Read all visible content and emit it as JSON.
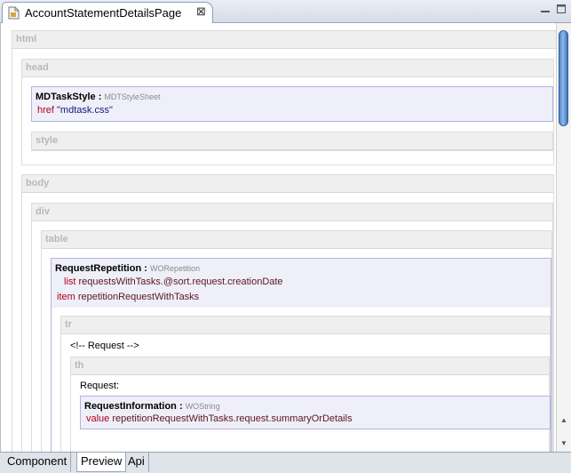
{
  "editor": {
    "tab_title": "AccountStatementDetailsPage",
    "close_symbol": "⊠"
  },
  "tree": {
    "html": "html",
    "head": "head",
    "style": "style",
    "body": "body",
    "div": "div",
    "table": "table",
    "tr": "tr",
    "th": "th",
    "comment": "<!-- Request -->",
    "request_text": "Request:",
    "mdtaskstyle": {
      "name": "MDTaskStyle",
      "sep": " : ",
      "type": "MDTStyleSheet",
      "bindings": [
        {
          "key": "href",
          "value": "\"mdtask.css\""
        }
      ]
    },
    "request_repetition": {
      "name": "RequestRepetition",
      "sep": " : ",
      "type": "WORepetition",
      "bindings": [
        {
          "key": "list",
          "value": "requestsWithTasks.@sort.request.creationDate"
        },
        {
          "key": "item",
          "value": "repetitionRequestWithTasks"
        }
      ]
    },
    "request_information": {
      "name": "RequestInformation",
      "sep": " : ",
      "type": "WOString",
      "bindings": [
        {
          "key": "value",
          "value": "repetitionRequestWithTasks.request.summaryOrDetails"
        }
      ]
    }
  },
  "bottom_tabs": [
    "Component",
    "Preview",
    "Api"
  ],
  "active_tab": "Preview"
}
